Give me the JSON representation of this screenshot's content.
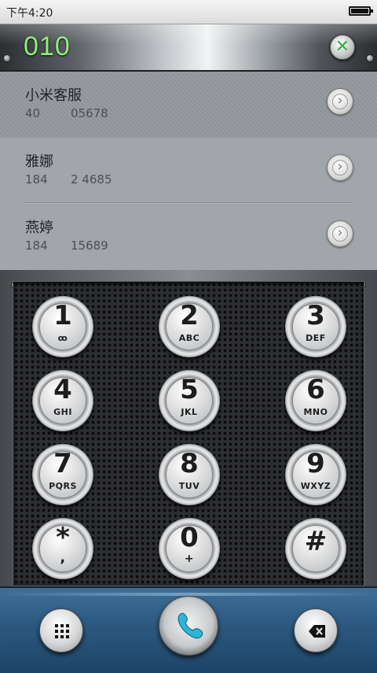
{
  "status_bar": {
    "time": "下午4:20"
  },
  "header": {
    "dialed_number": "010",
    "clear_icon": "clear-x-icon"
  },
  "contacts": [
    {
      "name": "小米客服",
      "num_a": "40",
      "num_b": "05678",
      "selected": true
    },
    {
      "name": "雅娜",
      "num_a": "184",
      "num_b": "2 4685",
      "selected": false
    },
    {
      "name": "燕婷",
      "num_a": "184",
      "num_b": "15689",
      "selected": false
    }
  ],
  "keypad": {
    "keys": [
      {
        "digit": "1",
        "letters": "ꝏ"
      },
      {
        "digit": "2",
        "letters": "ABC"
      },
      {
        "digit": "3",
        "letters": "DEF"
      },
      {
        "digit": "4",
        "letters": "GHI"
      },
      {
        "digit": "5",
        "letters": "JKL"
      },
      {
        "digit": "6",
        "letters": "MNO"
      },
      {
        "digit": "7",
        "letters": "PQRS"
      },
      {
        "digit": "8",
        "letters": "TUV"
      },
      {
        "digit": "9",
        "letters": "WXYZ"
      },
      {
        "digit": "*",
        "letters": ","
      },
      {
        "digit": "0",
        "letters": "+"
      },
      {
        "digit": "#",
        "letters": ""
      }
    ]
  },
  "bottom_bar": {
    "keypad_toggle_icon": "keypad-grid-icon",
    "call_icon": "phone-handset-icon",
    "backspace_icon": "backspace-icon",
    "accent_color": "#2d5a82",
    "call_icon_color": "#2bb6d8"
  }
}
